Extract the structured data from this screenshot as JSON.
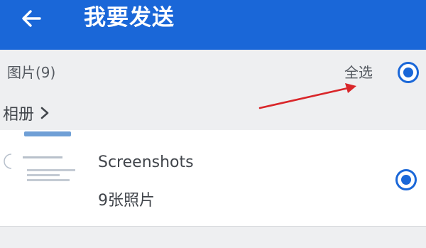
{
  "header": {
    "back_icon": "back-arrow-icon",
    "title": "我要发送",
    "background_color": "#1a67d8"
  },
  "section": {
    "title": "图片(9)",
    "select_all_label": "全选",
    "select_all_checked": true
  },
  "album_nav": {
    "label": "相册",
    "chevron_icon": "chevron-right-icon"
  },
  "albums": [
    {
      "name": "Screenshots",
      "count_text": "9张照片",
      "checked": true
    }
  ],
  "colors": {
    "accent": "#1a67d8",
    "background": "#eeeff1",
    "annotation": "#d9262a"
  }
}
